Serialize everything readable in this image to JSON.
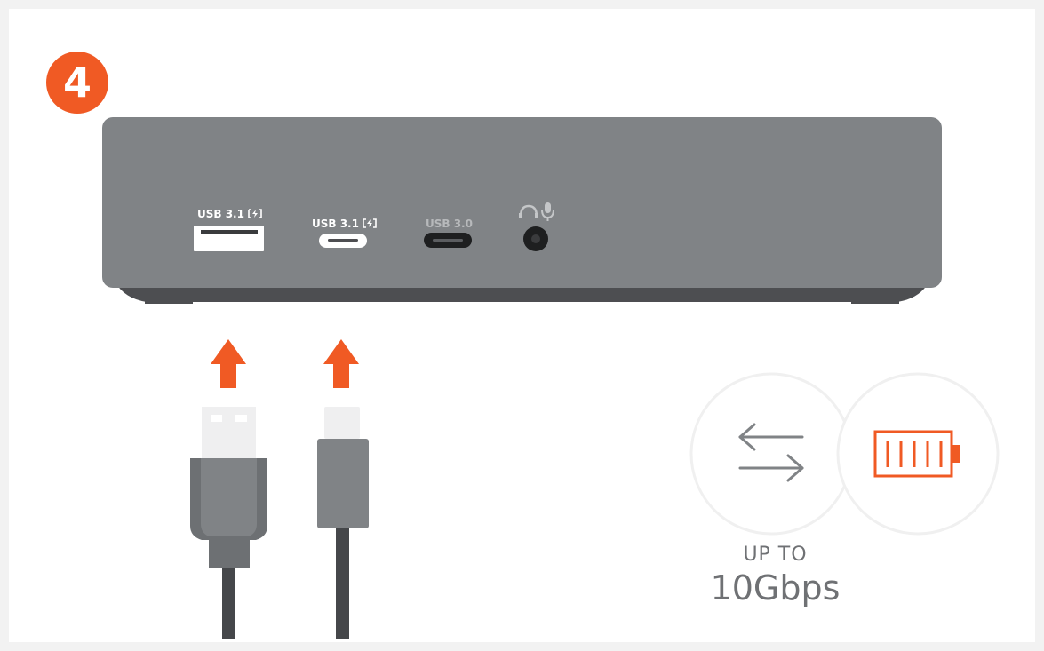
{
  "step": {
    "number": "4"
  },
  "dock": {
    "ports": [
      {
        "label": "USB 3.1",
        "icon": "power-delivery-icon",
        "type": "usb-a",
        "state": "highlighted"
      },
      {
        "label": "USB 3.1",
        "icon": "power-delivery-icon",
        "type": "usb-c",
        "state": "highlighted"
      },
      {
        "label": "USB 3.0",
        "type": "usb-c",
        "state": "dimmed"
      },
      {
        "icons": [
          "headphones-icon",
          "microphone-icon"
        ],
        "type": "audio-jack"
      }
    ]
  },
  "cables": [
    {
      "type": "usb-a",
      "arrow": "up"
    },
    {
      "type": "usb-c",
      "arrow": "up"
    }
  ],
  "features": {
    "icons": [
      "data-transfer-arrows-icon",
      "battery-charging-icon"
    ],
    "speed_prefix": "UP TO",
    "speed_value": "10Gbps"
  },
  "colors": {
    "accent": "#f05a24",
    "dock_body": "#808386",
    "dock_base": "#4d4e51",
    "cable_dark": "#45474a",
    "text_gray": "#6f7174",
    "background": "#f2f2f2"
  }
}
